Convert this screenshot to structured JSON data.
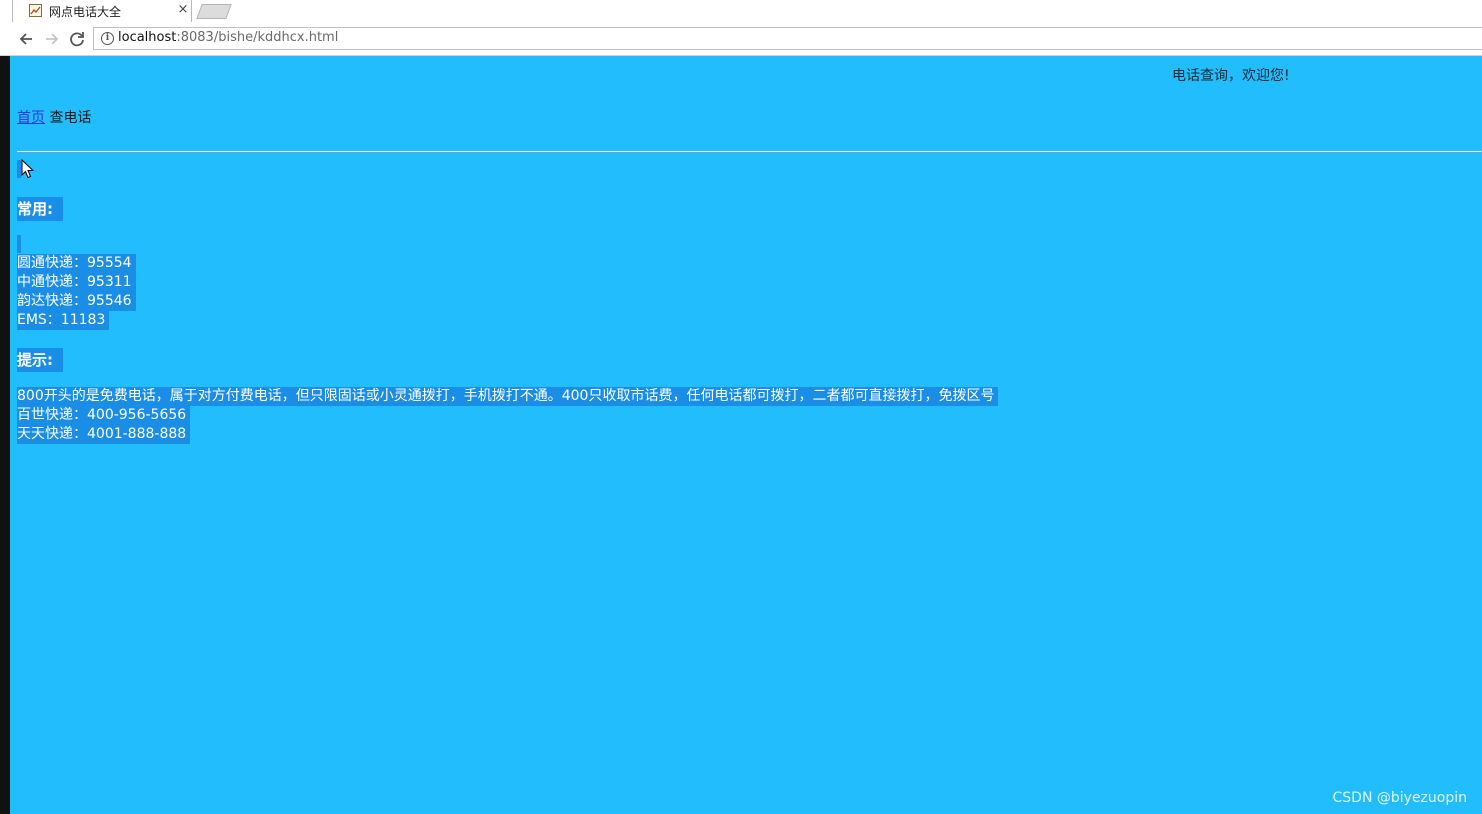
{
  "browser": {
    "tab_title": "网点电话大全",
    "url_host": "localhost",
    "url_rest": ":8083/bishe/kddhcx.html",
    "close_glyph": "×",
    "info_glyph": "i"
  },
  "page": {
    "welcome": "电话查询，欢迎您!",
    "breadcrumb": {
      "home": "首页",
      "current": "查电话"
    },
    "sections": {
      "common_heading": "常用:",
      "common_lines": [
        "圆通快递：95554",
        "中通快递：95311",
        "韵达快递：95546",
        "EMS：11183"
      ],
      "tips_heading": "提示:",
      "tips_lines": [
        "800开头的是免费电话，属于对方付费电话，但只限固话或小灵通拨打，手机拨打不通。400只收取市话费，任何电话都可拨打，二者都可直接拨打，免拨区号",
        "百世快递：400-956-5656",
        "天天快递：4001-888-888"
      ]
    },
    "watermark": "CSDN @biyezuopin"
  },
  "colors": {
    "page_background": "#21bdfd",
    "selection": "#1a8de6",
    "link": "#2a3bd8"
  },
  "icons": {
    "tab_favicon": "chart-image-icon",
    "back": "arrow-left-icon",
    "forward": "arrow-right-icon",
    "reload": "reload-icon",
    "site_info": "info-icon",
    "pointer": "mouse-cursor-icon"
  }
}
